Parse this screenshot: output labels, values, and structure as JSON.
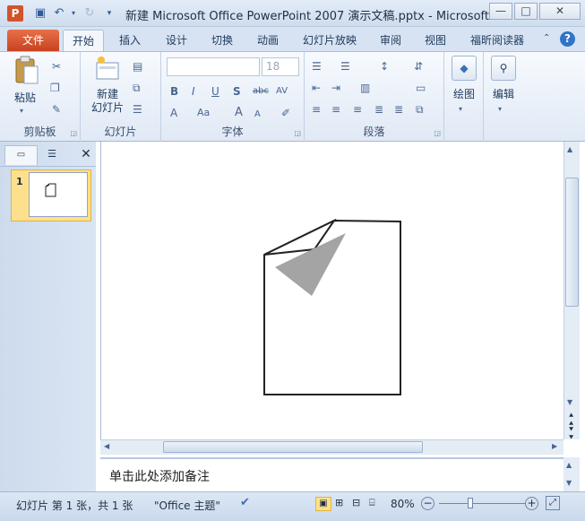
{
  "window": {
    "title": "新建 Microsoft Office PowerPoint 2007 演示文稿.pptx  -  Microsoft...",
    "app_icon": "P",
    "minimize": "—",
    "maximize": "□",
    "close": "✕"
  },
  "tabs": [
    "文件",
    "开始",
    "插入",
    "设计",
    "切换",
    "动画",
    "幻灯片放映",
    "审阅",
    "视图",
    "福昕阅读器"
  ],
  "ribbon": {
    "clipboard": {
      "label": "剪贴板",
      "paste": "粘贴"
    },
    "slides": {
      "label": "幻灯片",
      "new_slide": "新建\n幻灯片"
    },
    "font": {
      "label": "字体",
      "size": "18"
    },
    "paragraph": {
      "label": "段落"
    },
    "drawing": {
      "label": "绘图"
    },
    "editing": {
      "label": "编辑"
    }
  },
  "thumbnails": [
    {
      "number": "1"
    }
  ],
  "notes": {
    "placeholder": "单击此处添加备注"
  },
  "status": {
    "slide_info": "幻灯片 第 1 张，共 1 张",
    "theme": "\"Office 主题\"",
    "zoom": "80%"
  },
  "colors": {
    "file_tab": "#d2542b",
    "accent": "#1e395b"
  }
}
